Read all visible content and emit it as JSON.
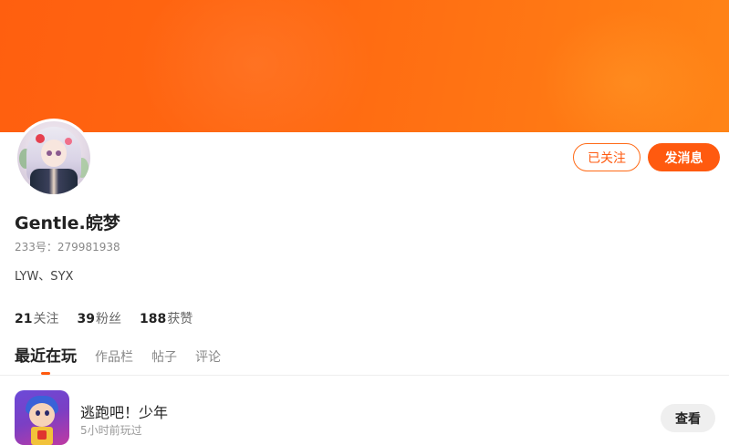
{
  "profile": {
    "name": "Gentle.皖梦",
    "uid_text": "233号：279981938",
    "bio": "LYW、SYX"
  },
  "actions": {
    "follow_label": "已关注",
    "message_label": "发消息"
  },
  "stats": [
    {
      "num": "21",
      "label": "关注"
    },
    {
      "num": "39",
      "label": "粉丝"
    },
    {
      "num": "188",
      "label": "获赞"
    }
  ],
  "tabs": [
    {
      "label": "最近在玩",
      "active": true
    },
    {
      "label": "作品栏",
      "active": false
    },
    {
      "label": "帖子",
      "active": false
    },
    {
      "label": "评论",
      "active": false
    }
  ],
  "recent_games": [
    {
      "title": "逃跑吧！少年",
      "time": "5小时前玩过",
      "button": "查看"
    }
  ],
  "colors": {
    "accent": "#ff5a0f",
    "banner_start": "#ff5f0f",
    "banner_end": "#ff8416"
  }
}
